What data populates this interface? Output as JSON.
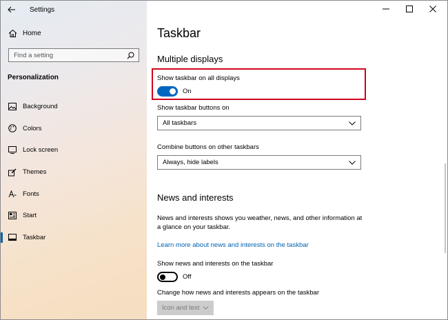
{
  "window": {
    "title": "Settings",
    "controls": [
      "minimize",
      "maximize",
      "close"
    ]
  },
  "sidebar": {
    "home_label": "Home",
    "search_placeholder": "Find a setting",
    "section_label": "Personalization",
    "items": [
      {
        "label": "Background",
        "icon": "image-icon"
      },
      {
        "label": "Colors",
        "icon": "palette-icon"
      },
      {
        "label": "Lock screen",
        "icon": "lock-screen-icon"
      },
      {
        "label": "Themes",
        "icon": "brush-icon"
      },
      {
        "label": "Fonts",
        "icon": "font-icon"
      },
      {
        "label": "Start",
        "icon": "start-icon"
      },
      {
        "label": "Taskbar",
        "icon": "taskbar-icon",
        "active": true
      }
    ]
  },
  "main": {
    "title": "Taskbar",
    "multiple_displays": {
      "heading": "Multiple displays",
      "show_taskbar_label": "Show taskbar on all displays",
      "show_taskbar_state": "On",
      "buttons_on_label": "Show taskbar buttons on",
      "buttons_on_value": "All taskbars",
      "combine_label": "Combine buttons on other taskbars",
      "combine_value": "Always, hide labels"
    },
    "news": {
      "heading": "News and interests",
      "description": "News and interests shows you weather, news, and other information at a glance on your taskbar.",
      "link": "Learn more about news and interests on the taskbar",
      "show_label": "Show news and interests on the taskbar",
      "show_state": "Off",
      "change_label": "Change how news and interests appears on the taskbar",
      "change_value": "Icon and text"
    }
  },
  "colors": {
    "accent": "#0067c0",
    "highlight_border": "#d0021b",
    "link": "#0063b1"
  }
}
